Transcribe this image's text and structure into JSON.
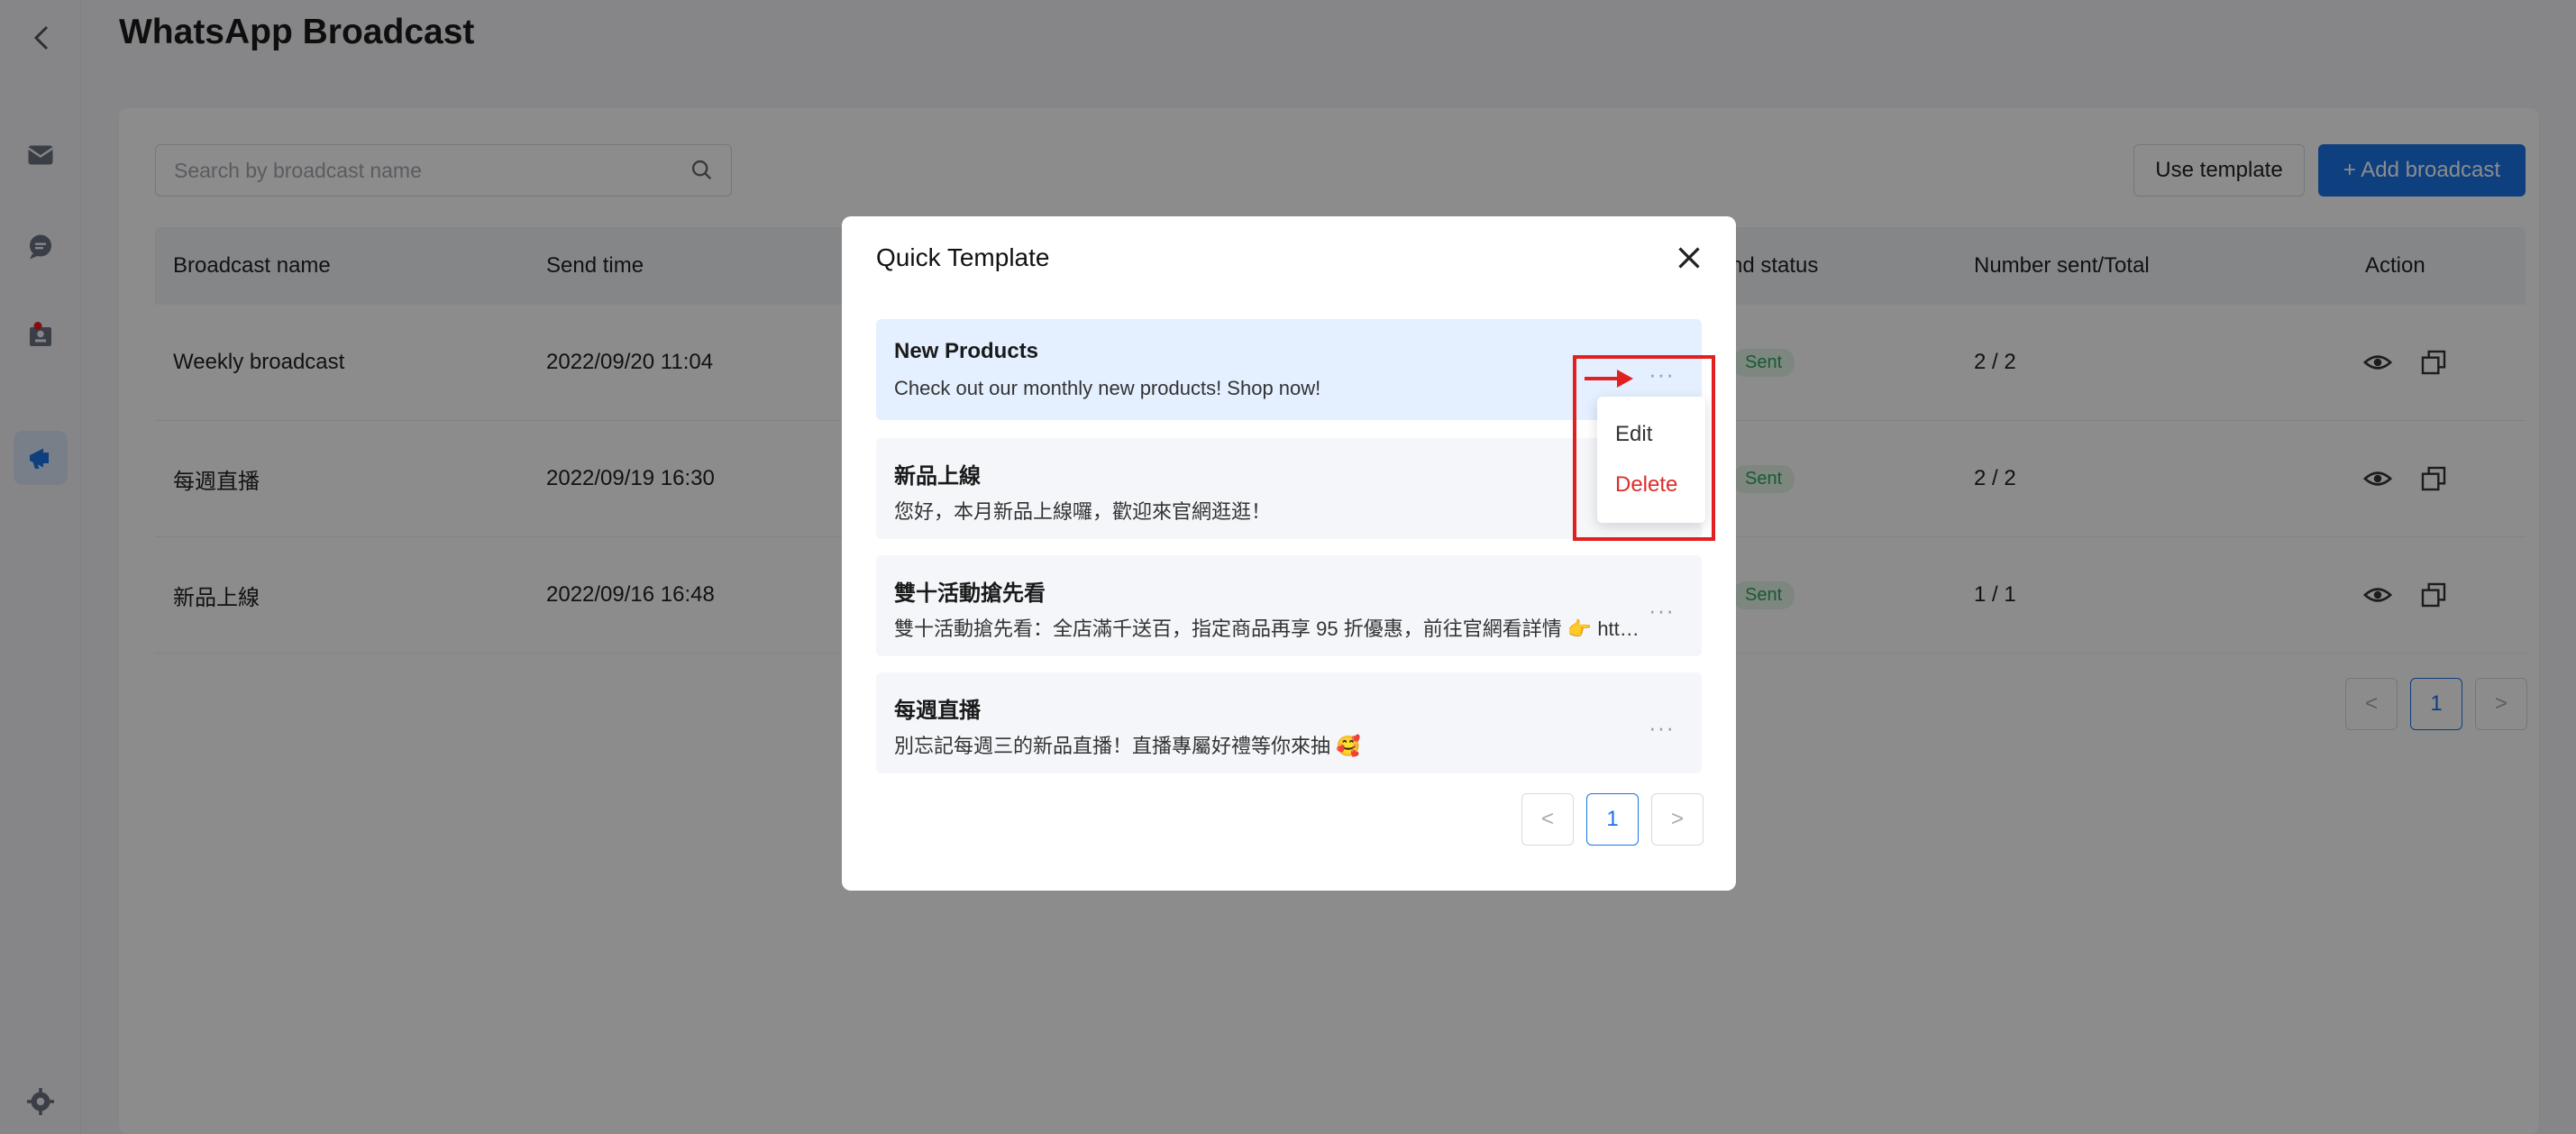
{
  "page": {
    "title": "WhatsApp Broadcast"
  },
  "sidebar": {
    "items": [
      {
        "icon": "mail-icon"
      },
      {
        "icon": "chat-icon"
      },
      {
        "icon": "contacts-icon"
      },
      {
        "icon": "megaphone-icon"
      }
    ],
    "bottom_icon": "gear-icon"
  },
  "toolbar": {
    "search_placeholder": "Search by broadcast name",
    "use_template_label": "Use template",
    "add_broadcast_label": "+ Add broadcast"
  },
  "table": {
    "columns": {
      "name": "Broadcast name",
      "send_time": "Send time",
      "status_partial": "nd status",
      "number": "Number sent/Total",
      "action": "Action"
    },
    "rows": [
      {
        "name": "Weekly broadcast",
        "send_time": "2022/09/20 11:04",
        "status": "Sent",
        "number": "2 / 2"
      },
      {
        "name": "每週直播",
        "send_time": "2022/09/19 16:30",
        "status": "Sent",
        "number": "2 / 2"
      },
      {
        "name": "新品上線",
        "send_time": "2022/09/16 16:48",
        "status": "Sent",
        "number": "1 / 1"
      }
    ],
    "pager": {
      "prev": "<",
      "current": "1",
      "next": ">"
    }
  },
  "modal": {
    "title": "Quick Template",
    "templates": [
      {
        "name": "New Products",
        "text": "Check out our monthly new products! Shop now!"
      },
      {
        "name": "新品上線",
        "text": "您好，本月新品上線囉，歡迎來官網逛逛！"
      },
      {
        "name": "雙十活動搶先看",
        "text": "雙十活動搶先看：全店滿千送百，指定商品再享 95 折優惠，前往官網看詳情 👉 https:/..."
      },
      {
        "name": "每週直播",
        "text": "別忘記每週三的新品直播！直播專屬好禮等你來抽 🥰"
      }
    ],
    "more_label": "···",
    "dropdown": {
      "edit": "Edit",
      "delete": "Delete"
    },
    "pager": {
      "prev": "<",
      "current": "1",
      "next": ">"
    }
  },
  "colors": {
    "primary": "#1a73e8",
    "danger": "#e02b2b",
    "sent": "#2ca45a",
    "highlight": "#e32020"
  }
}
